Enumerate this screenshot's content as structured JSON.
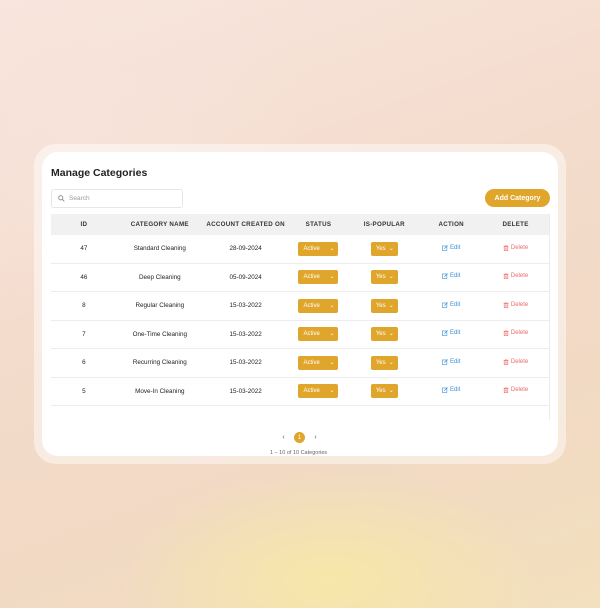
{
  "page": {
    "title": "Manage Categories",
    "search_placeholder": "Search",
    "add_button": "Add Category"
  },
  "table": {
    "headers": [
      "ID",
      "CATEGORY NAME",
      "ACCOUNT CREATED ON",
      "STATUS",
      "IS-POPULAR",
      "ACTION",
      "DELETE"
    ],
    "rows": [
      {
        "id": "47",
        "name": "Standard Cleaning",
        "created": "28-09-2024",
        "status": "Active",
        "popular": "Yes"
      },
      {
        "id": "46",
        "name": "Deep  Cleaning",
        "created": "05-09-2024",
        "status": "Active",
        "popular": "Yes"
      },
      {
        "id": "8",
        "name": "Regular Cleaning",
        "created": "15-03-2022",
        "status": "Active",
        "popular": "Yes"
      },
      {
        "id": "7",
        "name": "One-Time Cleaning",
        "created": "15-03-2022",
        "status": "Active",
        "popular": "Yes"
      },
      {
        "id": "6",
        "name": "Recurring Cleaning",
        "created": "15-03-2022",
        "status": "Active",
        "popular": "Yes"
      },
      {
        "id": "5",
        "name": "Move-In Cleaning",
        "created": "15-03-2022",
        "status": "Active",
        "popular": "Yes"
      }
    ],
    "edit_label": "Edit",
    "delete_label": "Delete"
  },
  "pagination": {
    "prev": "‹",
    "current": "1",
    "next": "›",
    "info": "1 – 10 of 10 Categories"
  },
  "colors": {
    "accent": "#e0a52b",
    "edit": "#3b8fd6",
    "delete": "#ec6b6b"
  }
}
